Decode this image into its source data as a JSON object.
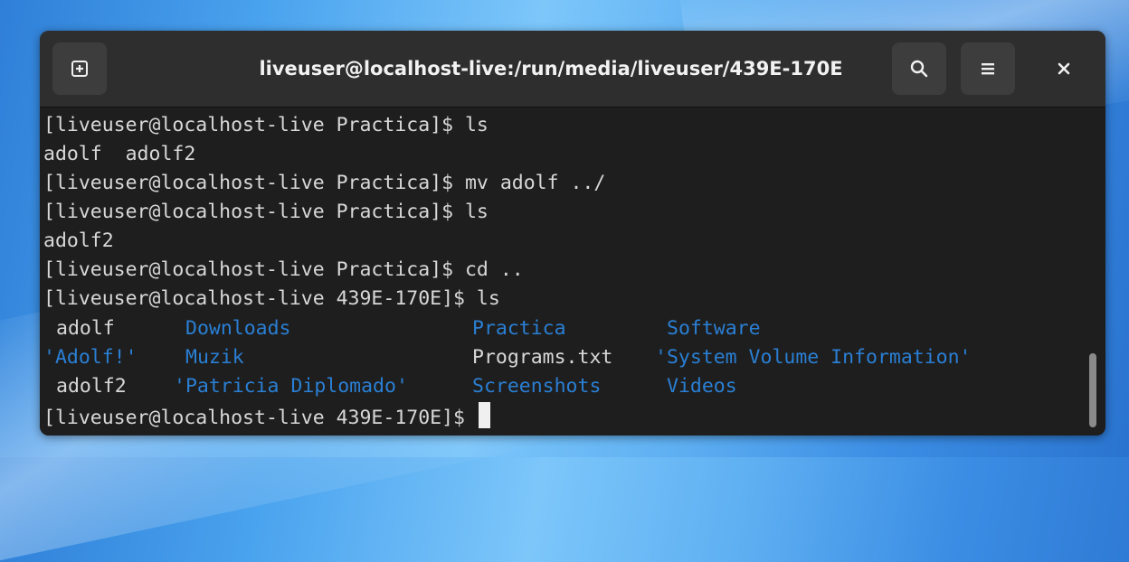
{
  "window": {
    "title": "liveuser@localhost-live:/run/media/liveuser/439E-170E",
    "close_glyph": "×"
  },
  "icons": {
    "new_tab": "new-tab-icon",
    "search": "search-icon",
    "menu": "hamburger-menu-icon",
    "close": "close-icon"
  },
  "terminal": {
    "lines": [
      "[liveuser@localhost-live Practica]$ ls",
      "adolf  adolf2",
      "[liveuser@localhost-live Practica]$ mv adolf ../",
      "[liveuser@localhost-live Practica]$ ls",
      "adolf2",
      "[liveuser@localhost-live Practica]$ cd ..",
      "[liveuser@localhost-live 439E-170E]$ ls"
    ],
    "listing": [
      [
        "adolf",
        "Downloads",
        "Practica",
        "Software"
      ],
      [
        "'Adolf!'",
        "Muzik",
        "Programs.txt",
        "'System Volume Information'"
      ],
      [
        "adolf2",
        "'Patricia Diplomado'",
        "Screenshots",
        "Videos"
      ]
    ],
    "prompt": "[liveuser@localhost-live 439E-170E]$ "
  },
  "colors": {
    "background": "#1e1e1e",
    "text": "#d8d8d8",
    "directory": "#2a7fd4",
    "headerbar": "#2e2e2e"
  }
}
